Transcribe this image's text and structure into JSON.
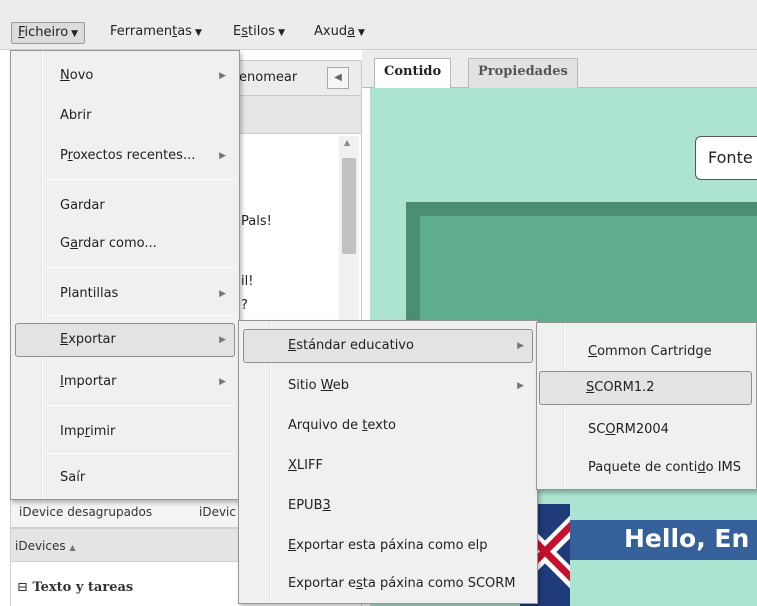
{
  "menubar": {
    "items": [
      {
        "pre": "",
        "u": "F",
        "post": "icheiro"
      },
      {
        "pre": "Ferramen",
        "u": "t",
        "post": "as"
      },
      {
        "pre": "E",
        "u": "s",
        "post": "tilos"
      },
      {
        "pre": "Axud",
        "u": "a",
        "post": ""
      }
    ]
  },
  "left_panel": {
    "renomear": "enomear",
    "tree_frags": [
      "Pals!",
      "il!",
      "?"
    ],
    "idevice_tabs": [
      "iDevice desagrupados",
      "iDevic"
    ],
    "idevices_header": "iDevices",
    "category": "Texto y tareas"
  },
  "content": {
    "tabs": [
      "Contido",
      "Propiedades"
    ],
    "fonte": "Fonte",
    "hello": "Hello, En"
  },
  "file_menu": {
    "items": [
      {
        "pre": "",
        "u": "N",
        "post": "ovo"
      },
      {
        "pre": "Abrir",
        "u": "",
        "post": ""
      },
      {
        "pre": "P",
        "u": "r",
        "post": "oxectos recentes..."
      },
      {
        "pre": "Gardar",
        "u": "",
        "post": ""
      },
      {
        "pre": "G",
        "u": "a",
        "post": "rdar como..."
      },
      {
        "pre": "Plantillas",
        "u": "",
        "post": ""
      },
      {
        "pre": "",
        "u": "E",
        "post": "xportar"
      },
      {
        "pre": "",
        "u": "I",
        "post": "mportar"
      },
      {
        "pre": "Imp",
        "u": "r",
        "post": "imir"
      },
      {
        "pre": "Saír",
        "u": "",
        "post": ""
      }
    ]
  },
  "export_menu": {
    "items": [
      {
        "pre": "",
        "u": "E",
        "post": "stándar educativo"
      },
      {
        "pre": "Sitio ",
        "u": "W",
        "post": "eb"
      },
      {
        "pre": "Arquivo de ",
        "u": "t",
        "post": "exto"
      },
      {
        "pre": "",
        "u": "X",
        "post": "LIFF"
      },
      {
        "pre": "EPUB",
        "u": "3",
        "post": ""
      },
      {
        "pre": "",
        "u": "E",
        "post": "xportar esta páxina como elp"
      },
      {
        "pre": "Exportar e",
        "u": "s",
        "post": "ta páxina como SCORM"
      }
    ]
  },
  "standard_menu": {
    "items": [
      {
        "pre": "",
        "u": "C",
        "post": "ommon Cartridge"
      },
      {
        "pre": "",
        "u": "S",
        "post": "CORM1.2"
      },
      {
        "pre": "SC",
        "u": "O",
        "post": "RM2004"
      },
      {
        "pre": "Paquete de conti",
        "u": "d",
        "post": "o IMS"
      }
    ]
  },
  "icons": {
    "submenu_arrow": "right-triangle-icon",
    "menu_caret": "down-triangle-icon",
    "collapse": "left-arrow-icon",
    "tree_toggle": "minus-square-icon"
  }
}
